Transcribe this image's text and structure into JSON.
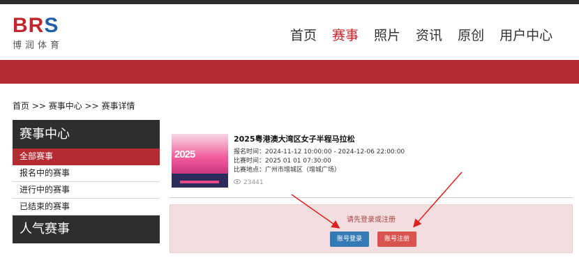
{
  "header": {
    "logo_main_b": "BR",
    "logo_main_s": "S",
    "logo_sub": "博润体育",
    "nav": [
      "首页",
      "赛事",
      "照片",
      "资讯",
      "原创",
      "用户中心"
    ],
    "active_nav": "赛事"
  },
  "breadcrumb": "首页 >> 赛事中心 >> 赛事详情",
  "sidebar": {
    "title": "赛事中心",
    "items": [
      "全部赛事",
      "报名中的赛事",
      "进行中的赛事",
      "已结束的赛事"
    ],
    "title2": "人气赛事"
  },
  "event": {
    "thumb_year": "2025",
    "title": "2025粤港澳大湾区女子半程马拉松",
    "reg_time": "报名时间：2024-11-12 10:00:00 - 2024-12-06 22:00:00",
    "race_time": "比赛时间：2025 01 01 07:30:00",
    "location": "比赛地点：广州市增城区（增城广场）",
    "views": "23441",
    "view_icon": "eye-icon"
  },
  "alert": {
    "message": "请先登录或注册",
    "login_label": "账号登录",
    "register_label": "账号注册"
  },
  "colors": {
    "brand_red": "#b52b31",
    "brand_blue": "#1f5fa8",
    "login_blue": "#337ab7",
    "register_red": "#d9534f",
    "arrow_red": "#e02020"
  }
}
